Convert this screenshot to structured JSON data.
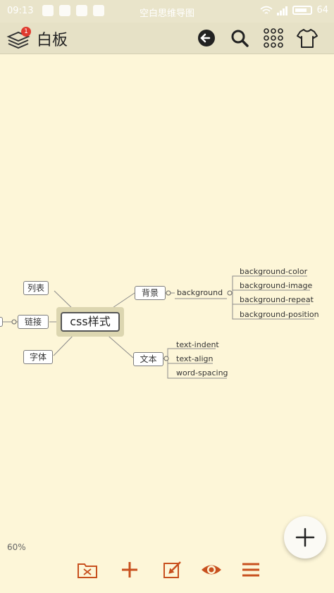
{
  "status_bar": {
    "time": "09:13",
    "carrier_text": "空白思维导图",
    "battery": "64"
  },
  "toolbar": {
    "title": "白板",
    "badge_count": "1",
    "icons": [
      "layers-icon",
      "back-icon",
      "search-icon",
      "structure-icon",
      "theme-icon"
    ]
  },
  "mindmap": {
    "root": "css样式",
    "left_branches": [
      "列表",
      "链接",
      "字体"
    ],
    "right_branches": [
      {
        "label": "背景",
        "children": [
          {
            "label": "background",
            "children": [
              "background-color",
              "background-image",
              "background-repeat",
              "background-position"
            ]
          }
        ]
      },
      {
        "label": "文本",
        "children": [
          "text-indent",
          "text-align",
          "word-spacing"
        ]
      }
    ]
  },
  "zoom_level": "60%",
  "accent_color": "#c8501e",
  "bottom_bar": {
    "icons": [
      "folder-icon",
      "add-icon",
      "edit-icon",
      "eye-icon",
      "menu-icon"
    ]
  }
}
